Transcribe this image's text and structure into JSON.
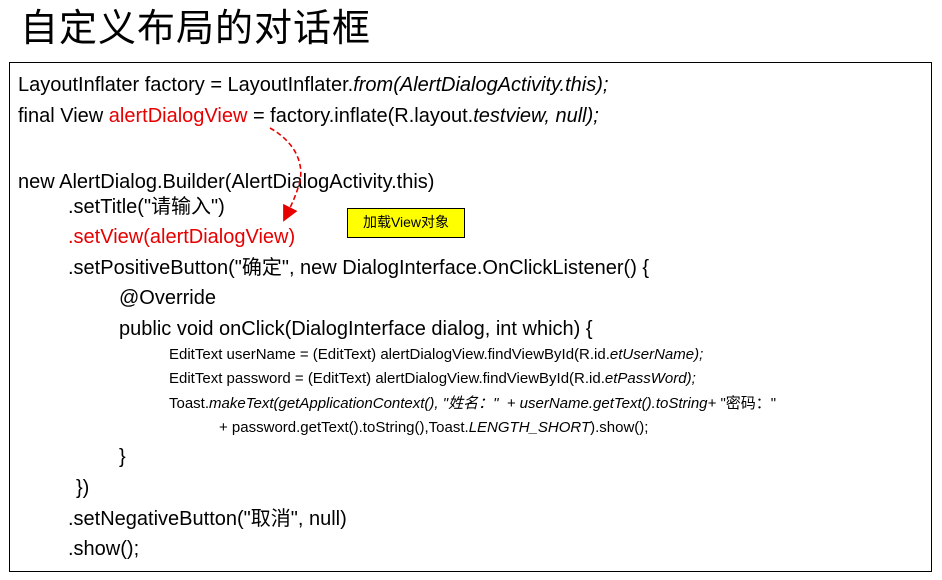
{
  "title": "自定义布局的对话框",
  "annotation": "加载View对象",
  "colors": {
    "highlight": "#e60000",
    "annotation_bg": "#ffff00"
  },
  "code": {
    "l1": {
      "a": "LayoutInflater factory = LayoutInflater.",
      "b": "from(AlertDialogActivity.this);"
    },
    "l2": {
      "a": "final View ",
      "b": "alertDialogView",
      "c": " = factory.inflate(R.layout.",
      "d": "testview, null);"
    },
    "l3": "new AlertDialog.Builder(AlertDialogActivity.this)",
    "l4": ".setTitle(\"请输入\")",
    "l5": ".setView(alertDialogView)",
    "l6": ".setPositiveButton(\"确定\", new DialogInterface.OnClickListener() {",
    "l7": "@Override",
    "l8": "public void onClick(DialogInterface dialog, int which) {",
    "l9": {
      "a": "EditText userName = (EditText) alertDialogView.findViewById(R.id.",
      "b": "etUserName);"
    },
    "l10": {
      "a": "EditText password = (EditText) alertDialogView.findViewById(R.id.",
      "b": "etPassWord);"
    },
    "l11": {
      "a": "Toast.",
      "b": "makeText(getApplicationContext(), \"姓名：\"  + userName.getText().toString+ ",
      "c": "\"密码：\""
    },
    "l12": {
      "a": "+ password.getText().toString(),Toast.",
      "b": "LENGTH_SHORT",
      "c": ").show();"
    },
    "l13": "}",
    "l14": "})",
    "l15": ".setNegativeButton(\"取消\", null)",
    "l16": ".show();"
  }
}
